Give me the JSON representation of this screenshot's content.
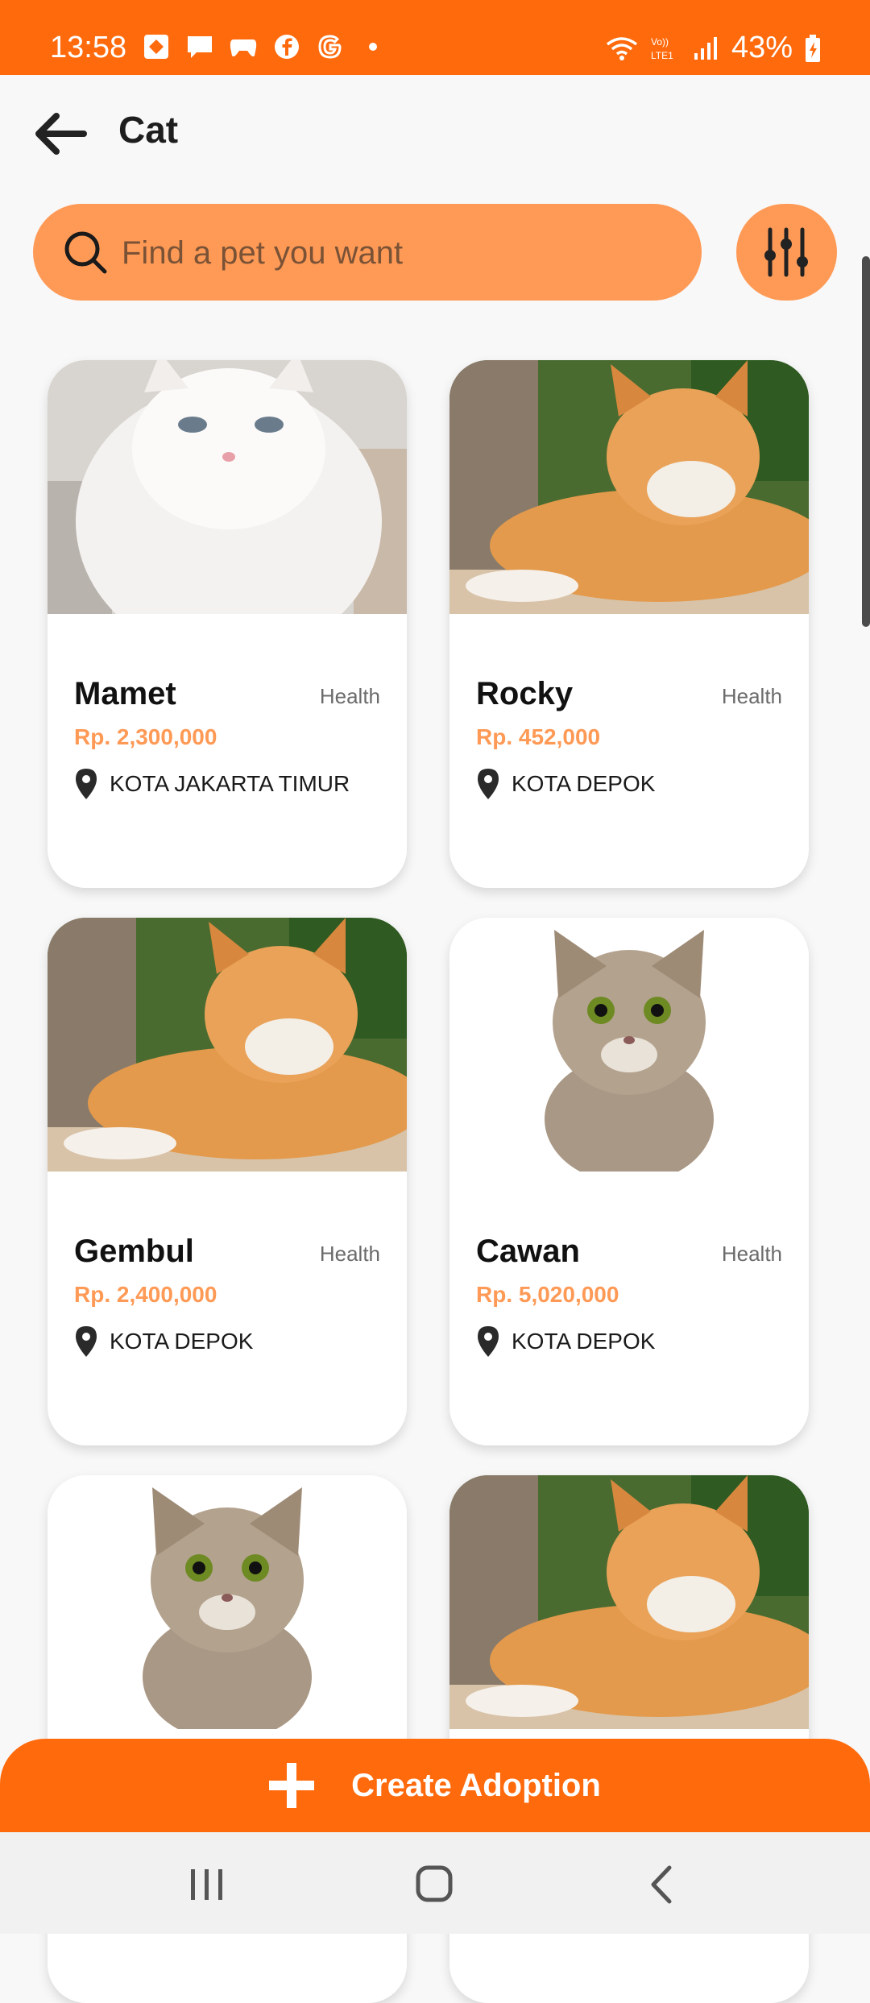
{
  "status": {
    "time": "13:58",
    "battery": "43%",
    "network_label": "Vo)) LTE1"
  },
  "header": {
    "title": "Cat"
  },
  "search": {
    "placeholder": "Find a pet you want"
  },
  "pets": [
    {
      "name": "Mamet",
      "tag": "Health",
      "price": "Rp. 2,300,000",
      "location": "KOTA JAKARTA TIMUR",
      "photo": "white-persian-cat"
    },
    {
      "name": "Rocky",
      "tag": "Health",
      "price": "Rp. 452,000",
      "location": "KOTA DEPOK",
      "photo": "orange-tabby-cat"
    },
    {
      "name": "Gembul",
      "tag": "Health",
      "price": "Rp. 2,400,000",
      "location": "KOTA DEPOK",
      "photo": "orange-tabby-cat"
    },
    {
      "name": "Cawan",
      "tag": "Health",
      "price": "Rp. 5,020,000",
      "location": "KOTA DEPOK",
      "photo": "grey-tabby-kitten"
    },
    {
      "name": "",
      "tag": "",
      "price": "",
      "location": "",
      "photo": "grey-tabby-kitten"
    },
    {
      "name": "",
      "tag": "",
      "price": "",
      "location": "",
      "photo": "orange-tabby-cat"
    }
  ],
  "actions": {
    "create_label": "Create Adoption"
  },
  "colors": {
    "primary": "#ff6a0d",
    "accent": "#ff9a56"
  }
}
